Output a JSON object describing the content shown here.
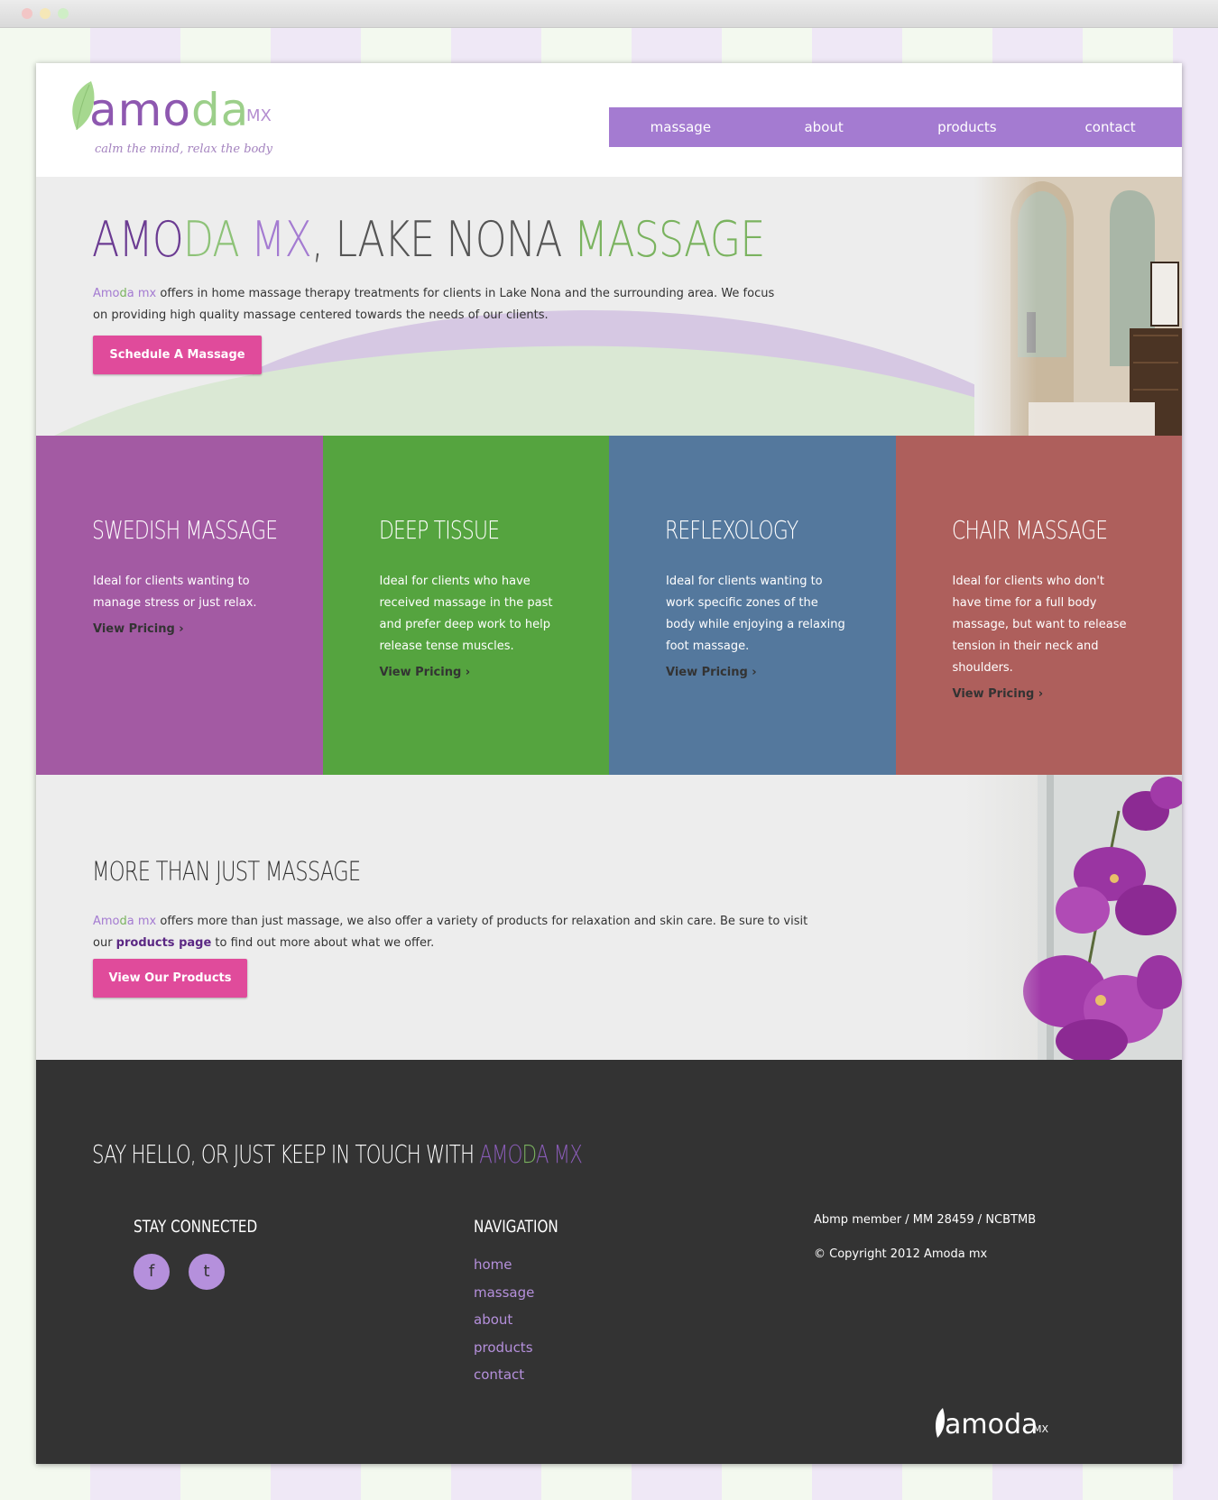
{
  "colors": {
    "nav": "#a47bd1",
    "button": "#e04b9b",
    "swedish": "#a35aa3",
    "deep_tissue": "#55a43f",
    "reflexology": "#54789d",
    "chair": "#ae5f5c",
    "footer": "#333333"
  },
  "header": {
    "logo": {
      "word_start": "amo",
      "word_end": "da",
      "mx": "MX",
      "tagline": "calm the mind, relax the body"
    },
    "nav": [
      "massage",
      "about",
      "products",
      "contact"
    ]
  },
  "hero": {
    "title": {
      "p1": "AMO",
      "p2": "DA",
      "p3": " MX",
      "p4": ", LAKE NONA ",
      "p5": "MASSAGE"
    },
    "brand": {
      "a1": "Amo",
      "a2": "d",
      "a3": "a mx"
    },
    "text": " offers in home massage therapy treatments for clients in Lake Nona and the surrounding area. We focus on providing high quality massage centered towards the needs of our clients.",
    "button": "Schedule A Massage"
  },
  "services": [
    {
      "title": "SWEDISH MASSAGE",
      "text": "Ideal for clients wanting to manage stress or just relax.",
      "link": "View Pricing ›"
    },
    {
      "title": "DEEP TISSUE",
      "text": "Ideal for clients who have received massage in the past and prefer deep work to help release tense muscles.",
      "link": "View Pricing ›"
    },
    {
      "title": "REFLEXOLOGY",
      "text": "Ideal for clients wanting to work specific zones of the body while enjoying a relaxing foot massage.",
      "link": "View Pricing ›"
    },
    {
      "title": "CHAIR MASSAGE",
      "text": "Ideal for clients who don't have time for a full body massage, but want to release tension in their neck and shoulders.",
      "link": "View Pricing ›"
    }
  ],
  "more": {
    "title": "MORE THAN JUST MASSAGE",
    "text1": " offers more than just massage, we also offer a variety of products for relaxation and skin care. Be sure to visit our ",
    "link": "products page",
    "text2": " to find out more about what we offer.",
    "button": "View Our Products"
  },
  "footer": {
    "title": {
      "t1": "SAY HELLO, OR JUST KEEP IN TOUCH WITH ",
      "t2": "AMO",
      "t3": "D",
      "t4": "A MX"
    },
    "stay_connected": "STAY CONNECTED",
    "social": [
      "f",
      "t"
    ],
    "navigation_heading": "NAVIGATION",
    "nav": [
      "home",
      "massage",
      "about",
      "products",
      "contact"
    ],
    "membership": "Abmp member / MM 28459 / NCBTMB",
    "copyright": "© Copyright 2012 Amoda mx",
    "logo": {
      "word": "amoda",
      "mx": "MX"
    }
  }
}
